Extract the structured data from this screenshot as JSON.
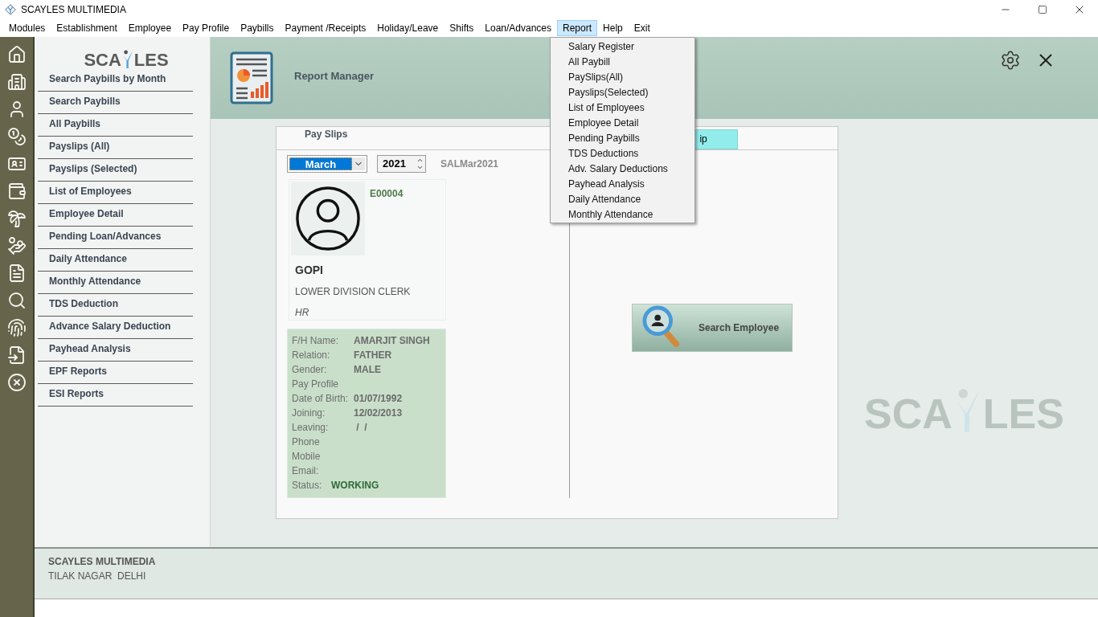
{
  "window": {
    "title": "SCAYLES MULTIMEDIA"
  },
  "menu_bar": [
    {
      "label": "Modules",
      "selected": false
    },
    {
      "label": "Establishment",
      "selected": false
    },
    {
      "label": "Employee",
      "selected": false
    },
    {
      "label": "Pay Profile",
      "selected": false
    },
    {
      "label": "Paybills",
      "selected": false
    },
    {
      "label": "Payment /Receipts",
      "selected": false
    },
    {
      "label": "Holiday/Leave",
      "selected": false
    },
    {
      "label": "Shifts",
      "selected": false
    },
    {
      "label": "Loan/Advances",
      "selected": false
    },
    {
      "label": "Report",
      "selected": true
    },
    {
      "label": "Help",
      "selected": false
    },
    {
      "label": "Exit",
      "selected": false
    }
  ],
  "report_menu": [
    "Salary Register",
    "All Paybill",
    "PaySlips(All)",
    "Payslips(Selected)",
    "List of Employees",
    "Employee Detail",
    "Pending Paybills",
    "TDS Deductions",
    "Adv. Salary Deductions",
    "Payhead Analysis",
    "Daily Attendance",
    "Monthly Attendance"
  ],
  "logo": {
    "left": "SCA",
    "right": "LES"
  },
  "background_logo": {
    "left": "SCA",
    "right": "LES"
  },
  "sidebar": [
    "Search Paybills by Month",
    "Search Paybills",
    "All Paybills",
    "Payslips (All)",
    "Payslips (Selected)",
    "List of Employees",
    "Employee Detail",
    "Pending Loan/Advances",
    "Daily Attendance",
    "Monthly Attendance",
    "TDS Deduction",
    "Advance Salary Deduction",
    "Payhead Analysis",
    "EPF Reports",
    "ESI Reports"
  ],
  "header": {
    "title": "Report Manager"
  },
  "card": {
    "title": "Pay Slips",
    "month": "March",
    "year": "2021",
    "code": "SALMar2021",
    "cut_button": "ip",
    "employee": {
      "id": "E00004",
      "name": "GOPI",
      "designation": "LOWER DIVISION CLERK",
      "department": "HR"
    },
    "details": [
      {
        "label": "F/H Name:",
        "value": "AMARJIT SINGH"
      },
      {
        "label": "Relation:",
        "value": "FATHER"
      },
      {
        "label": "Gender:",
        "value": "MALE"
      },
      {
        "label": "Pay Profile"
      },
      {
        "label": "Date of Birth:",
        "value": "01/07/1992"
      },
      {
        "label": "Joining:",
        "value": "12/02/2013"
      },
      {
        "label": "Leaving:",
        "value": " /  /"
      },
      {
        "label": "Phone"
      },
      {
        "label": "Mobile"
      },
      {
        "label": "Email:"
      }
    ],
    "status": {
      "label": "Status:",
      "value": "WORKING"
    },
    "search_button": "Search Employee"
  },
  "footer": {
    "company": "SCAYLES MULTIMEDIA",
    "address": "TILAK NAGAR  DELHI"
  }
}
